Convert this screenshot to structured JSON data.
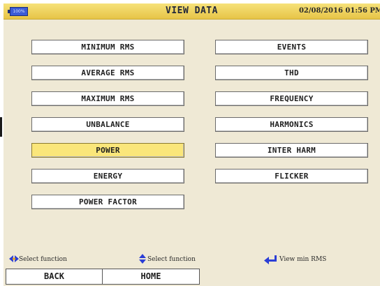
{
  "header": {
    "battery_label": "100%",
    "title": "VIEW DATA",
    "datetime": "02/08/2016 01:56 PM"
  },
  "menu": {
    "left": [
      {
        "label": "MINIMUM RMS",
        "selected": false
      },
      {
        "label": "AVERAGE RMS",
        "selected": false
      },
      {
        "label": "MAXIMUM RMS",
        "selected": false
      },
      {
        "label": "UNBALANCE",
        "selected": false
      },
      {
        "label": "POWER",
        "selected": true
      },
      {
        "label": "ENERGY",
        "selected": false
      },
      {
        "label": "POWER FACTOR",
        "selected": false
      }
    ],
    "right": [
      {
        "label": "EVENTS",
        "selected": false
      },
      {
        "label": "THD",
        "selected": false
      },
      {
        "label": "FREQUENCY",
        "selected": false
      },
      {
        "label": "HARMONICS",
        "selected": false
      },
      {
        "label": "INTER HARM",
        "selected": false
      },
      {
        "label": "FLICKER",
        "selected": false
      }
    ]
  },
  "hints": {
    "left_right": "Select function",
    "up_down": "Select function",
    "enter": "View min RMS"
  },
  "softkeys": {
    "back": "BACK",
    "home": "HOME"
  },
  "colors": {
    "background": "#efe9d5",
    "selected": "#fae67a",
    "titlebar": "#e7c447",
    "arrow_icon": "#2b3ed6"
  }
}
